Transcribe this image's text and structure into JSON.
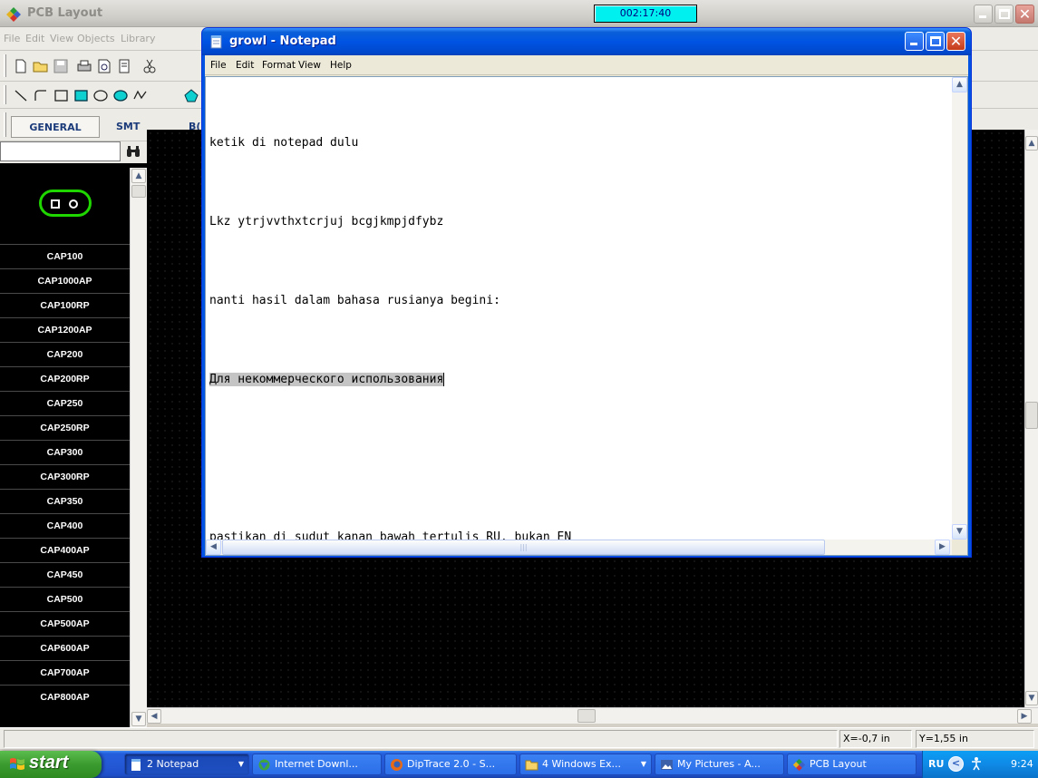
{
  "pcb_window": {
    "title": "PCB Layout",
    "timer": "002:17:40",
    "menu": [
      "File",
      "Edit",
      "View",
      "Objects",
      "Library"
    ],
    "tabs": [
      "GENERAL",
      "SMT",
      "B("
    ],
    "library_items": [
      "CAP100",
      "CAP1000AP",
      "CAP100RP",
      "CAP1200AP",
      "CAP200",
      "CAP200RP",
      "CAP250",
      "CAP250RP",
      "CAP300",
      "CAP300RP",
      "CAP350",
      "CAP400",
      "CAP400AP",
      "CAP450",
      "CAP500",
      "CAP500AP",
      "CAP600AP",
      "CAP700AP",
      "CAP800AP"
    ],
    "search_value": "",
    "status": {
      "x": "X=-0,7 in",
      "y": "Y=1,55 in"
    },
    "colors": {
      "canvas": "#000000",
      "pad": "#1fd600",
      "timer_bg": "#00f0f0"
    }
  },
  "notepad": {
    "title": "growl - Notepad",
    "menu": [
      "File",
      "Edit",
      "Format",
      "View",
      "Help"
    ],
    "lines": [
      "ketik di notepad dulu",
      "Lkz ytrjvvthxtcrjuj bcgjkmpjdfybz",
      "nanti hasil dalam bahasa rusianya begini:",
      "Для некоммерческого использования",
      "",
      "pastikan di sudut kanan bawah tertulis RU, bukan EN"
    ]
  },
  "taskbar": {
    "start_label": "start",
    "buttons": [
      {
        "label": "2 Notepad",
        "icon": "notepad-icon"
      },
      {
        "label": "Internet Downl...",
        "icon": "globe-icon"
      },
      {
        "label": "DipTrace 2.0 - S...",
        "icon": "firefox-icon"
      },
      {
        "label": "4 Windows Ex...",
        "icon": "folder-icon"
      },
      {
        "label": "My Pictures - A...",
        "icon": "picture-icon"
      },
      {
        "label": "PCB Layout",
        "icon": "pcb-icon"
      }
    ],
    "tray_lang": "RU",
    "clock": "9:24"
  }
}
